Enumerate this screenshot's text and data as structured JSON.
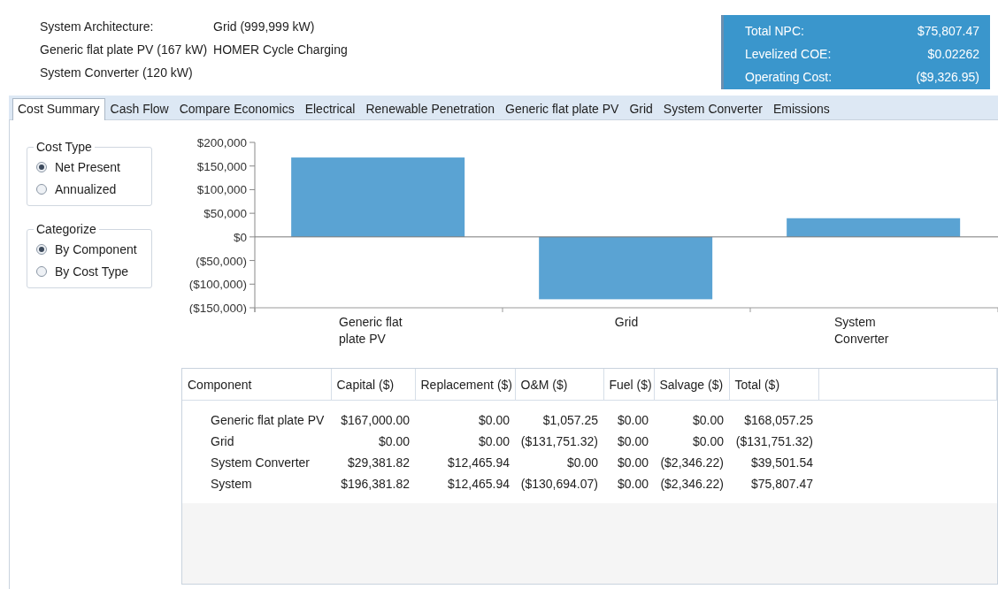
{
  "architecture": [
    {
      "label": "System Architecture:",
      "value": "Grid (999,999 kW)"
    },
    {
      "label": "Generic flat plate PV (167 kW)",
      "value": "HOMER Cycle Charging"
    },
    {
      "label": "System Converter (120 kW)"
    }
  ],
  "summary": [
    {
      "label": "Total NPC:",
      "value": "$75,807.47"
    },
    {
      "label": "Levelized COE:",
      "value": "$0.02262"
    },
    {
      "label": "Operating Cost:",
      "value": "($9,326.95)"
    }
  ],
  "tabs": [
    {
      "label": "Cost Summary",
      "selected": true
    },
    {
      "label": "Cash Flow",
      "selected": false
    },
    {
      "label": "Compare Economics",
      "selected": false
    },
    {
      "label": "Electrical",
      "selected": false
    },
    {
      "label": "Renewable Penetration",
      "selected": false
    },
    {
      "label": "Generic flat plate PV",
      "selected": false
    },
    {
      "label": "Grid",
      "selected": false
    },
    {
      "label": "System Converter",
      "selected": false
    },
    {
      "label": "Emissions",
      "selected": false
    }
  ],
  "option_groups": [
    {
      "title": "Cost Type",
      "options": [
        {
          "label": "Net Present",
          "selected": true
        },
        {
          "label": "Annualized",
          "selected": false
        }
      ]
    },
    {
      "title": "Categorize",
      "options": [
        {
          "label": "By Component",
          "selected": true
        },
        {
          "label": "By Cost Type",
          "selected": false
        }
      ]
    }
  ],
  "chart": {
    "chart_data": {
      "type": "bar",
      "categories": [
        "Generic flat plate PV",
        "Grid",
        "System Converter"
      ],
      "values": [
        168000,
        -132000,
        39500
      ],
      "ylim": [
        -150000,
        200000
      ],
      "yticks": [
        {
          "value": 200000,
          "label": "$200,000"
        },
        {
          "value": 150000,
          "label": "$150,000"
        },
        {
          "value": 100000,
          "label": "$100,000"
        },
        {
          "value": 50000,
          "label": "$50,000"
        },
        {
          "value": 0,
          "label": "$0"
        },
        {
          "value": -50000,
          "label": "($50,000)"
        },
        {
          "value": -100000,
          "label": "($100,000)"
        },
        {
          "value": -150000,
          "label": "($150,000)"
        }
      ]
    }
  },
  "table": {
    "columns": [
      "Component",
      "Capital ($)",
      "Replacement ($)",
      "O&M ($)",
      "Fuel ($)",
      "Salvage ($)",
      "Total ($)"
    ],
    "rows": [
      [
        "Generic flat plate PV",
        "$167,000.00",
        "$0.00",
        "$1,057.25",
        "$0.00",
        "$0.00",
        "$168,057.25"
      ],
      [
        "Grid",
        "$0.00",
        "$0.00",
        "($131,751.32)",
        "$0.00",
        "$0.00",
        "($131,751.32)"
      ],
      [
        "System Converter",
        "$29,381.82",
        "$12,465.94",
        "$0.00",
        "$0.00",
        "($2,346.22)",
        "$39,501.54"
      ],
      [
        "System",
        "$196,381.82",
        "$12,465.94",
        "($130,694.07)",
        "$0.00",
        "($2,346.22)",
        "$75,807.47"
      ]
    ]
  }
}
